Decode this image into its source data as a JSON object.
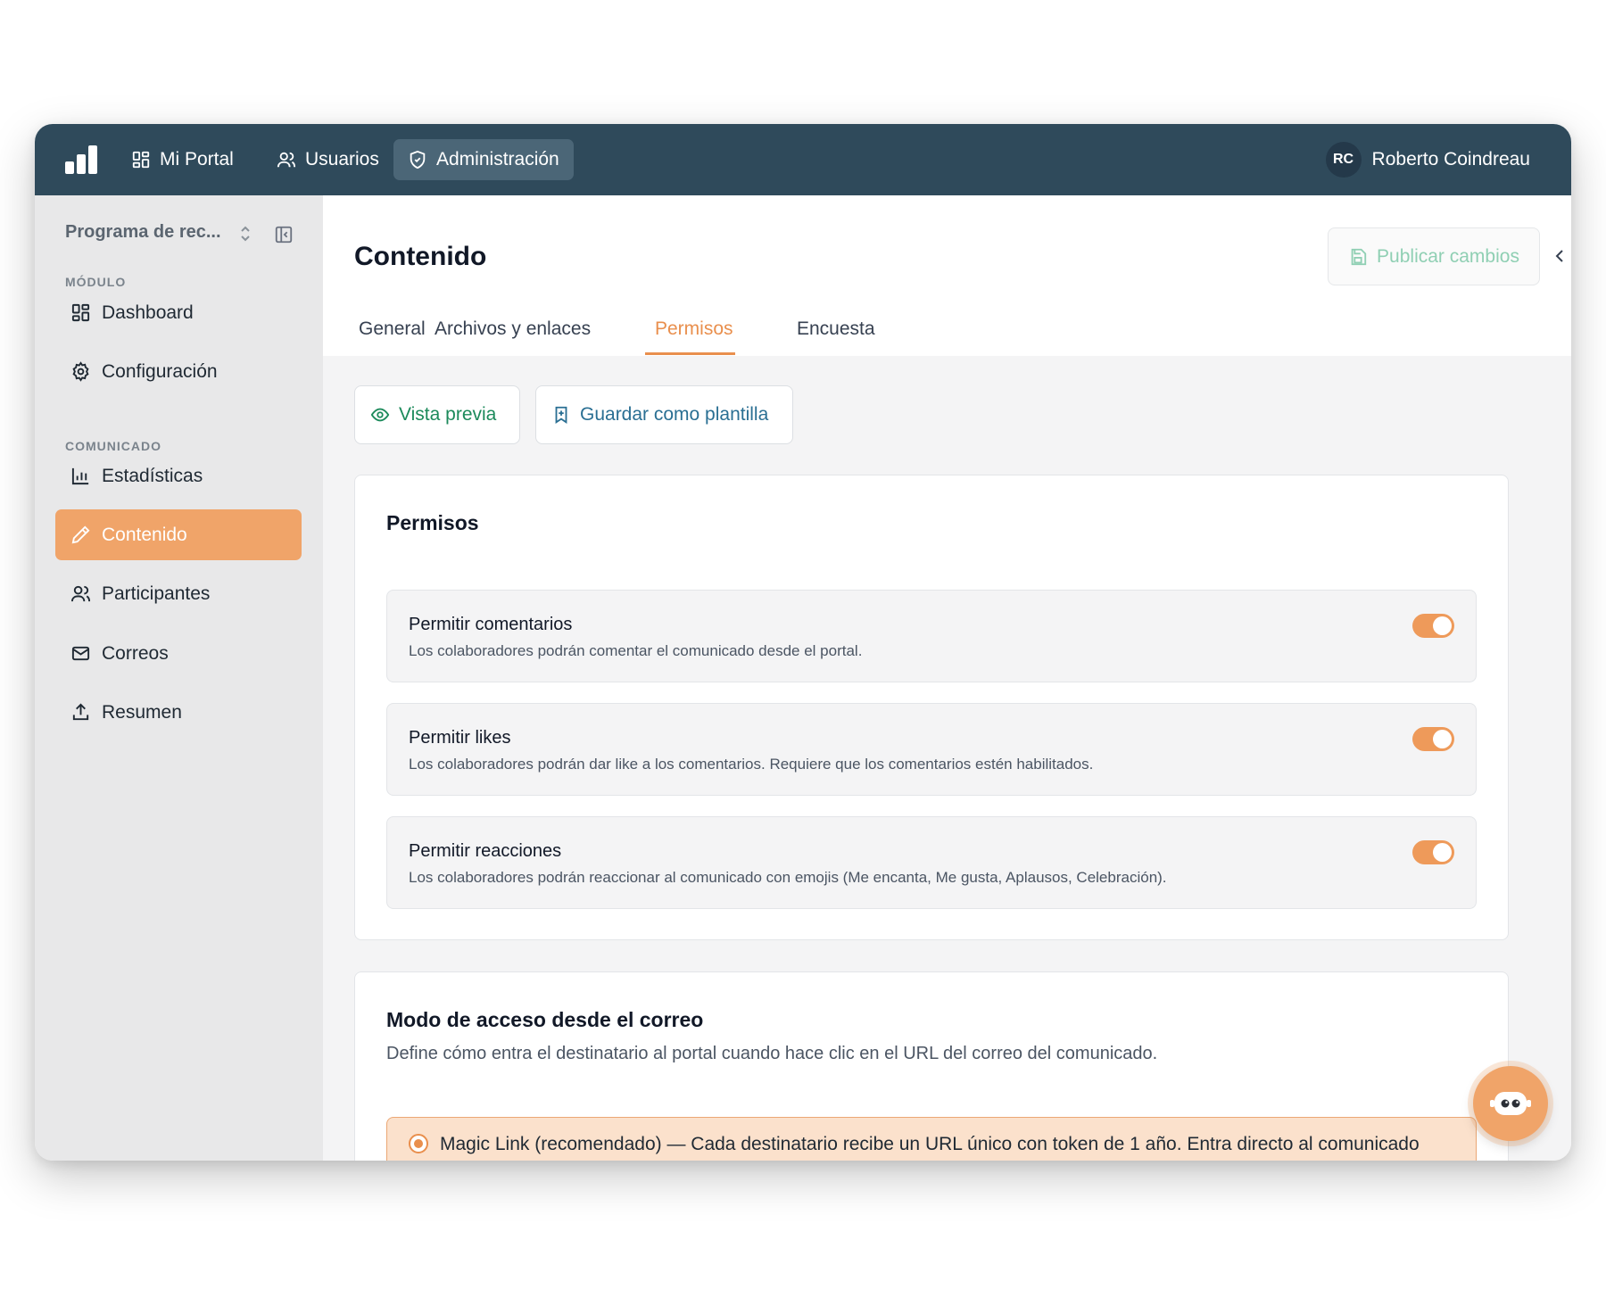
{
  "topbar": {
    "nav": [
      {
        "label": "Mi Portal",
        "icon": "grid-icon"
      },
      {
        "label": "Usuarios",
        "icon": "users-icon"
      },
      {
        "label": "Administración",
        "icon": "shield-icon"
      }
    ],
    "user": {
      "initials": "RC",
      "name": "Roberto Coindreau"
    }
  },
  "sidebar": {
    "program": "Programa de rec...",
    "sections": {
      "module": "MÓDULO",
      "communique": "COMUNICADO"
    },
    "items": [
      {
        "label": "Dashboard",
        "icon": "grid-icon"
      },
      {
        "label": "Configuración",
        "icon": "gear-icon"
      },
      {
        "label": "Estadísticas",
        "icon": "bar-chart-icon"
      },
      {
        "label": "Contenido",
        "icon": "pencil-icon"
      },
      {
        "label": "Participantes",
        "icon": "users-icon"
      },
      {
        "label": "Correos",
        "icon": "mail-icon"
      },
      {
        "label": "Resumen",
        "icon": "upload-icon"
      }
    ]
  },
  "header": {
    "title": "Contenido",
    "publish_label": "Publicar cambios",
    "tabs": [
      "General",
      "Archivos y enlaces",
      "Permisos",
      "Encuesta"
    ],
    "active_tab": "Permisos"
  },
  "actions": {
    "preview": "Vista previa",
    "save_template": "Guardar como plantilla"
  },
  "permissions": {
    "title": "Permisos",
    "items": [
      {
        "title": "Permitir comentarios",
        "desc": "Los colaboradores podrán comentar el comunicado desde el portal.",
        "enabled": true
      },
      {
        "title": "Permitir likes",
        "desc": "Los colaboradores podrán dar like a los comentarios. Requiere que los comentarios estén habilitados.",
        "enabled": true
      },
      {
        "title": "Permitir reacciones",
        "desc": "Los colaboradores podrán reaccionar al comunicado con emojis (Me encanta, Me gusta, Aplausos, Celebración).",
        "enabled": true
      }
    ]
  },
  "access": {
    "title": "Modo de acceso desde el correo",
    "desc": "Define cómo entra el destinatario al portal cuando hace clic en el URL del correo del comunicado.",
    "option_label": "Magic Link (recomendado) — Cada destinatario recibe un URL único con token de 1 año. Entra directo al comunicado"
  },
  "colors": {
    "topbar": "#2f4a5b",
    "accent": "#f0a469",
    "sidebar": "#e8e8e9",
    "publish_text": "#8fcfb3"
  }
}
